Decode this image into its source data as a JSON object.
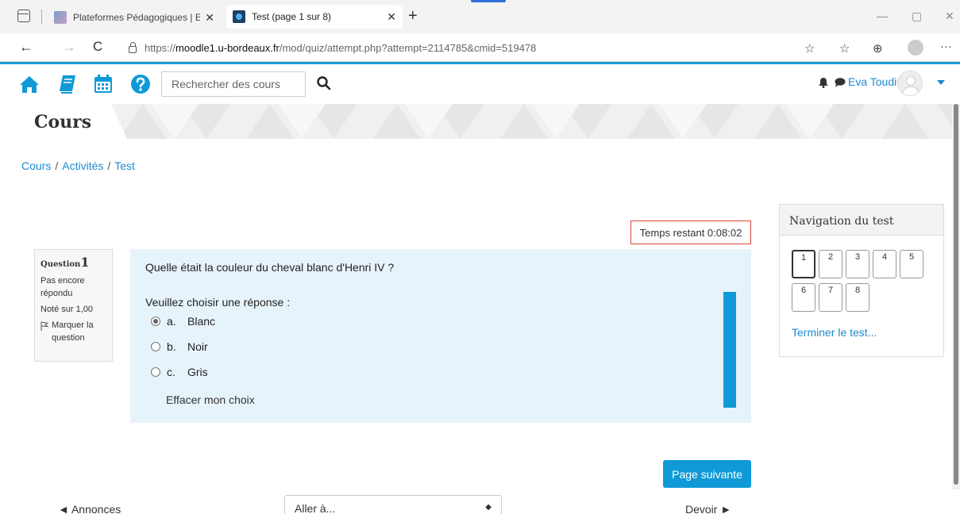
{
  "browser": {
    "tabs": [
      {
        "title": "Plateformes Pédagogiques | ENT",
        "close": "✕"
      },
      {
        "title": "Test (page 1 sur 8)",
        "close": "✕"
      }
    ],
    "new_tab": "+",
    "url_prefix": "https://",
    "url_host": "moodle1.u-bordeaux.fr",
    "url_path": "/mod/quiz/attempt.php?attempt=2114785&cmid=519478",
    "back": "←",
    "forward": "→",
    "refresh": "C",
    "more": "···"
  },
  "navbar": {
    "search_placeholder": "Rechercher des cours",
    "username": "Eva Toudire"
  },
  "header": {
    "title": "Cours"
  },
  "breadcrumb": [
    "Cours",
    "Activités",
    "Test"
  ],
  "breadcrumb_sep": "/",
  "quiz": {
    "timer": "Temps restant 0:08:02",
    "question_label": "Question",
    "question_number": "1",
    "status": "Pas encore répondu",
    "grade": "Noté sur 1,00",
    "flag": "Marquer la question",
    "question_text": "Quelle était la couleur du cheval blanc d'Henri IV ?",
    "prompt": "Veuillez choisir une réponse :",
    "answers": [
      {
        "letter": "a.",
        "text": "Blanc",
        "checked": true
      },
      {
        "letter": "b.",
        "text": "Noir",
        "checked": false
      },
      {
        "letter": "c.",
        "text": "Gris",
        "checked": false
      }
    ],
    "clear_choice": "Effacer mon choix",
    "next_button": "Page suivante"
  },
  "bottom_nav": {
    "prev": "◄ Annonces",
    "jump": "Aller à...",
    "next": "Devoir ►"
  },
  "navigation_block": {
    "title": "Navigation du test",
    "questions": [
      "1",
      "2",
      "3",
      "4",
      "5",
      "6",
      "7",
      "8"
    ],
    "current": "1",
    "finish": "Terminer le test..."
  },
  "colors": {
    "accent": "#0f9ad7",
    "link": "#1d8ad1",
    "timer_border": "#e0453a",
    "question_bg": "#e7f3fb"
  }
}
